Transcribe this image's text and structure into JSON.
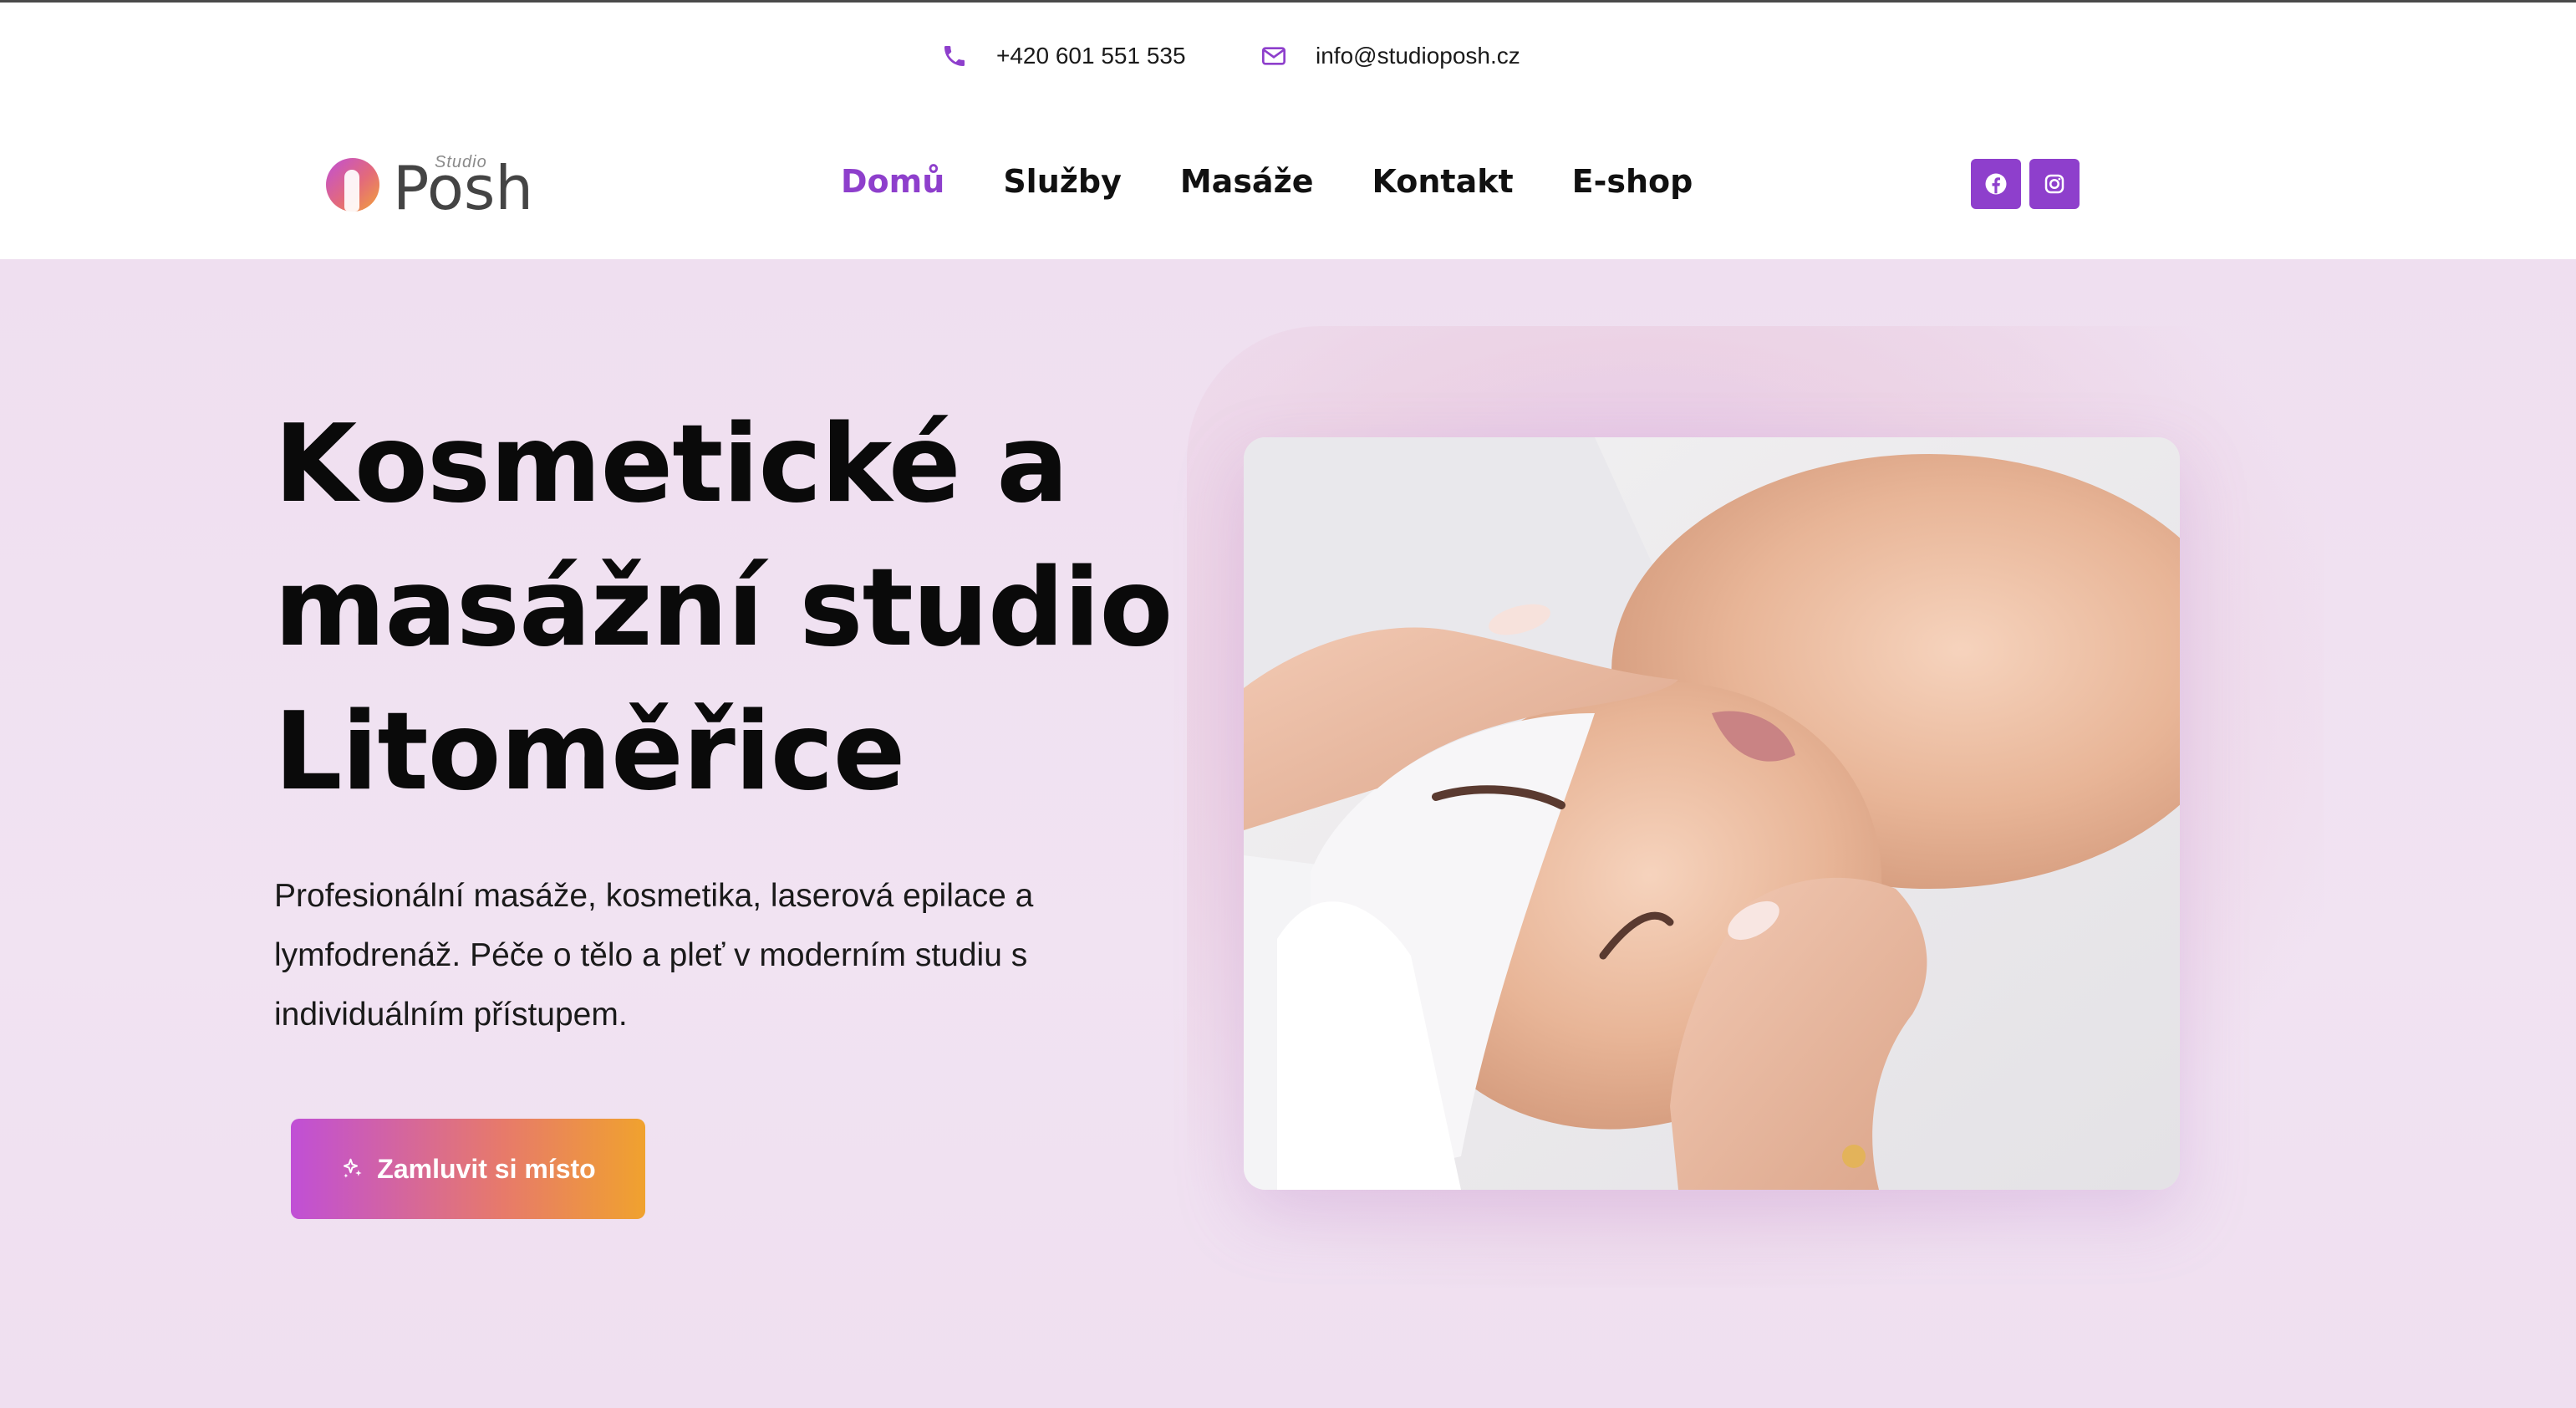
{
  "contact": {
    "phone": "+420 601 551 535",
    "email": "info@studioposh.cz"
  },
  "logo": {
    "small_text": "Studio",
    "text": "Posh"
  },
  "nav": {
    "items": [
      {
        "label": "Domů",
        "active": true
      },
      {
        "label": "Služby",
        "active": false
      },
      {
        "label": "Masáže",
        "active": false
      },
      {
        "label": "Kontakt",
        "active": false
      },
      {
        "label": "E-shop",
        "active": false
      }
    ]
  },
  "social": {
    "icons": [
      "facebook-icon",
      "instagram-icon"
    ]
  },
  "hero": {
    "title_lines": [
      "Kosmetické a",
      "masážní studio",
      "Litoměřice"
    ],
    "description_lines": [
      "Profesionální masáže, kosmetika, laserová epilace a",
      "lymfodrenáž. Péče o tělo a pleť v moderním studiu s",
      "individuálním přístupem."
    ],
    "cta_label": "Zamluvit si místo"
  },
  "colors": {
    "accent": "#8e3fcc",
    "hero_background": "#efdff0",
    "cta_gradient_start": "#c04fd6",
    "cta_gradient_end": "#f0a22e"
  }
}
